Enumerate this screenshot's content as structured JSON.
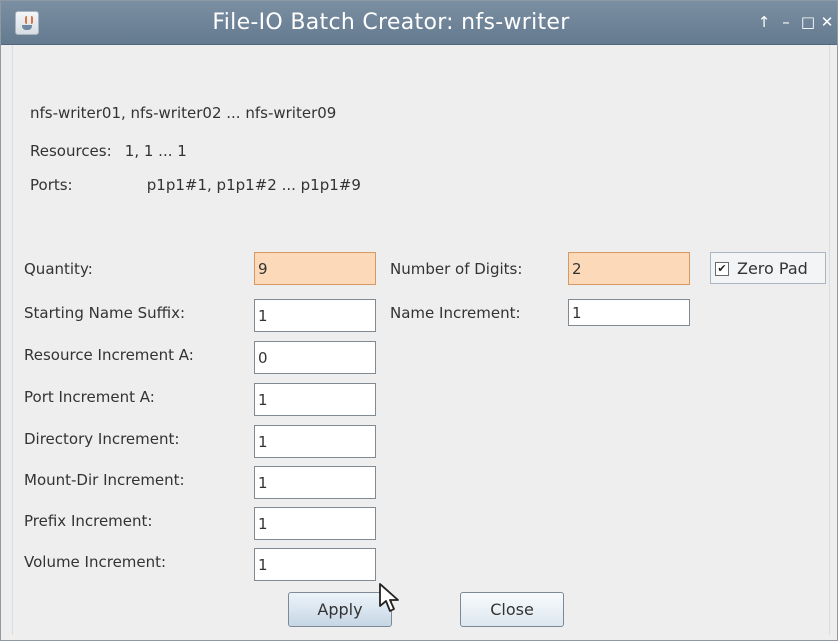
{
  "window": {
    "title": "File-IO Batch Creator: nfs-writer",
    "controls": {
      "pin": "↑",
      "minimize": "–",
      "maximize": "□",
      "close": "✕"
    }
  },
  "info": {
    "names": "nfs-writer01, nfs-writer02 ... nfs-writer09",
    "resources_label": "Resources:",
    "resources_value": "1, 1 ... 1",
    "ports_label": "Ports:",
    "ports_value": "p1p1#1, p1p1#2 ... p1p1#9"
  },
  "form": {
    "quantity": {
      "label": "Quantity:",
      "value": "9"
    },
    "digits": {
      "label": "Number of Digits:",
      "value": "2"
    },
    "zero_pad": {
      "label": "Zero Pad",
      "checked": true,
      "glyph": "✔"
    },
    "start_suffix": {
      "label": "Starting Name Suffix:",
      "value": "1"
    },
    "name_increment": {
      "label": "Name Increment:",
      "value": "1"
    },
    "resource_increment": {
      "label": "Resource Increment A:",
      "value": "0"
    },
    "port_increment": {
      "label": "Port Increment A:",
      "value": "1"
    },
    "directory_increment": {
      "label": "Directory Increment:",
      "value": "1"
    },
    "mount_dir_increment": {
      "label": "Mount-Dir Increment:",
      "value": "1"
    },
    "prefix_increment": {
      "label": "Prefix Increment:",
      "value": "1"
    },
    "volume_increment": {
      "label": "Volume Increment:",
      "value": "1"
    }
  },
  "buttons": {
    "apply": "Apply",
    "close": "Close"
  },
  "colors": {
    "titlebar": "#6e8499",
    "highlight_field": "#fcd9b9",
    "background": "#eeeeee"
  }
}
